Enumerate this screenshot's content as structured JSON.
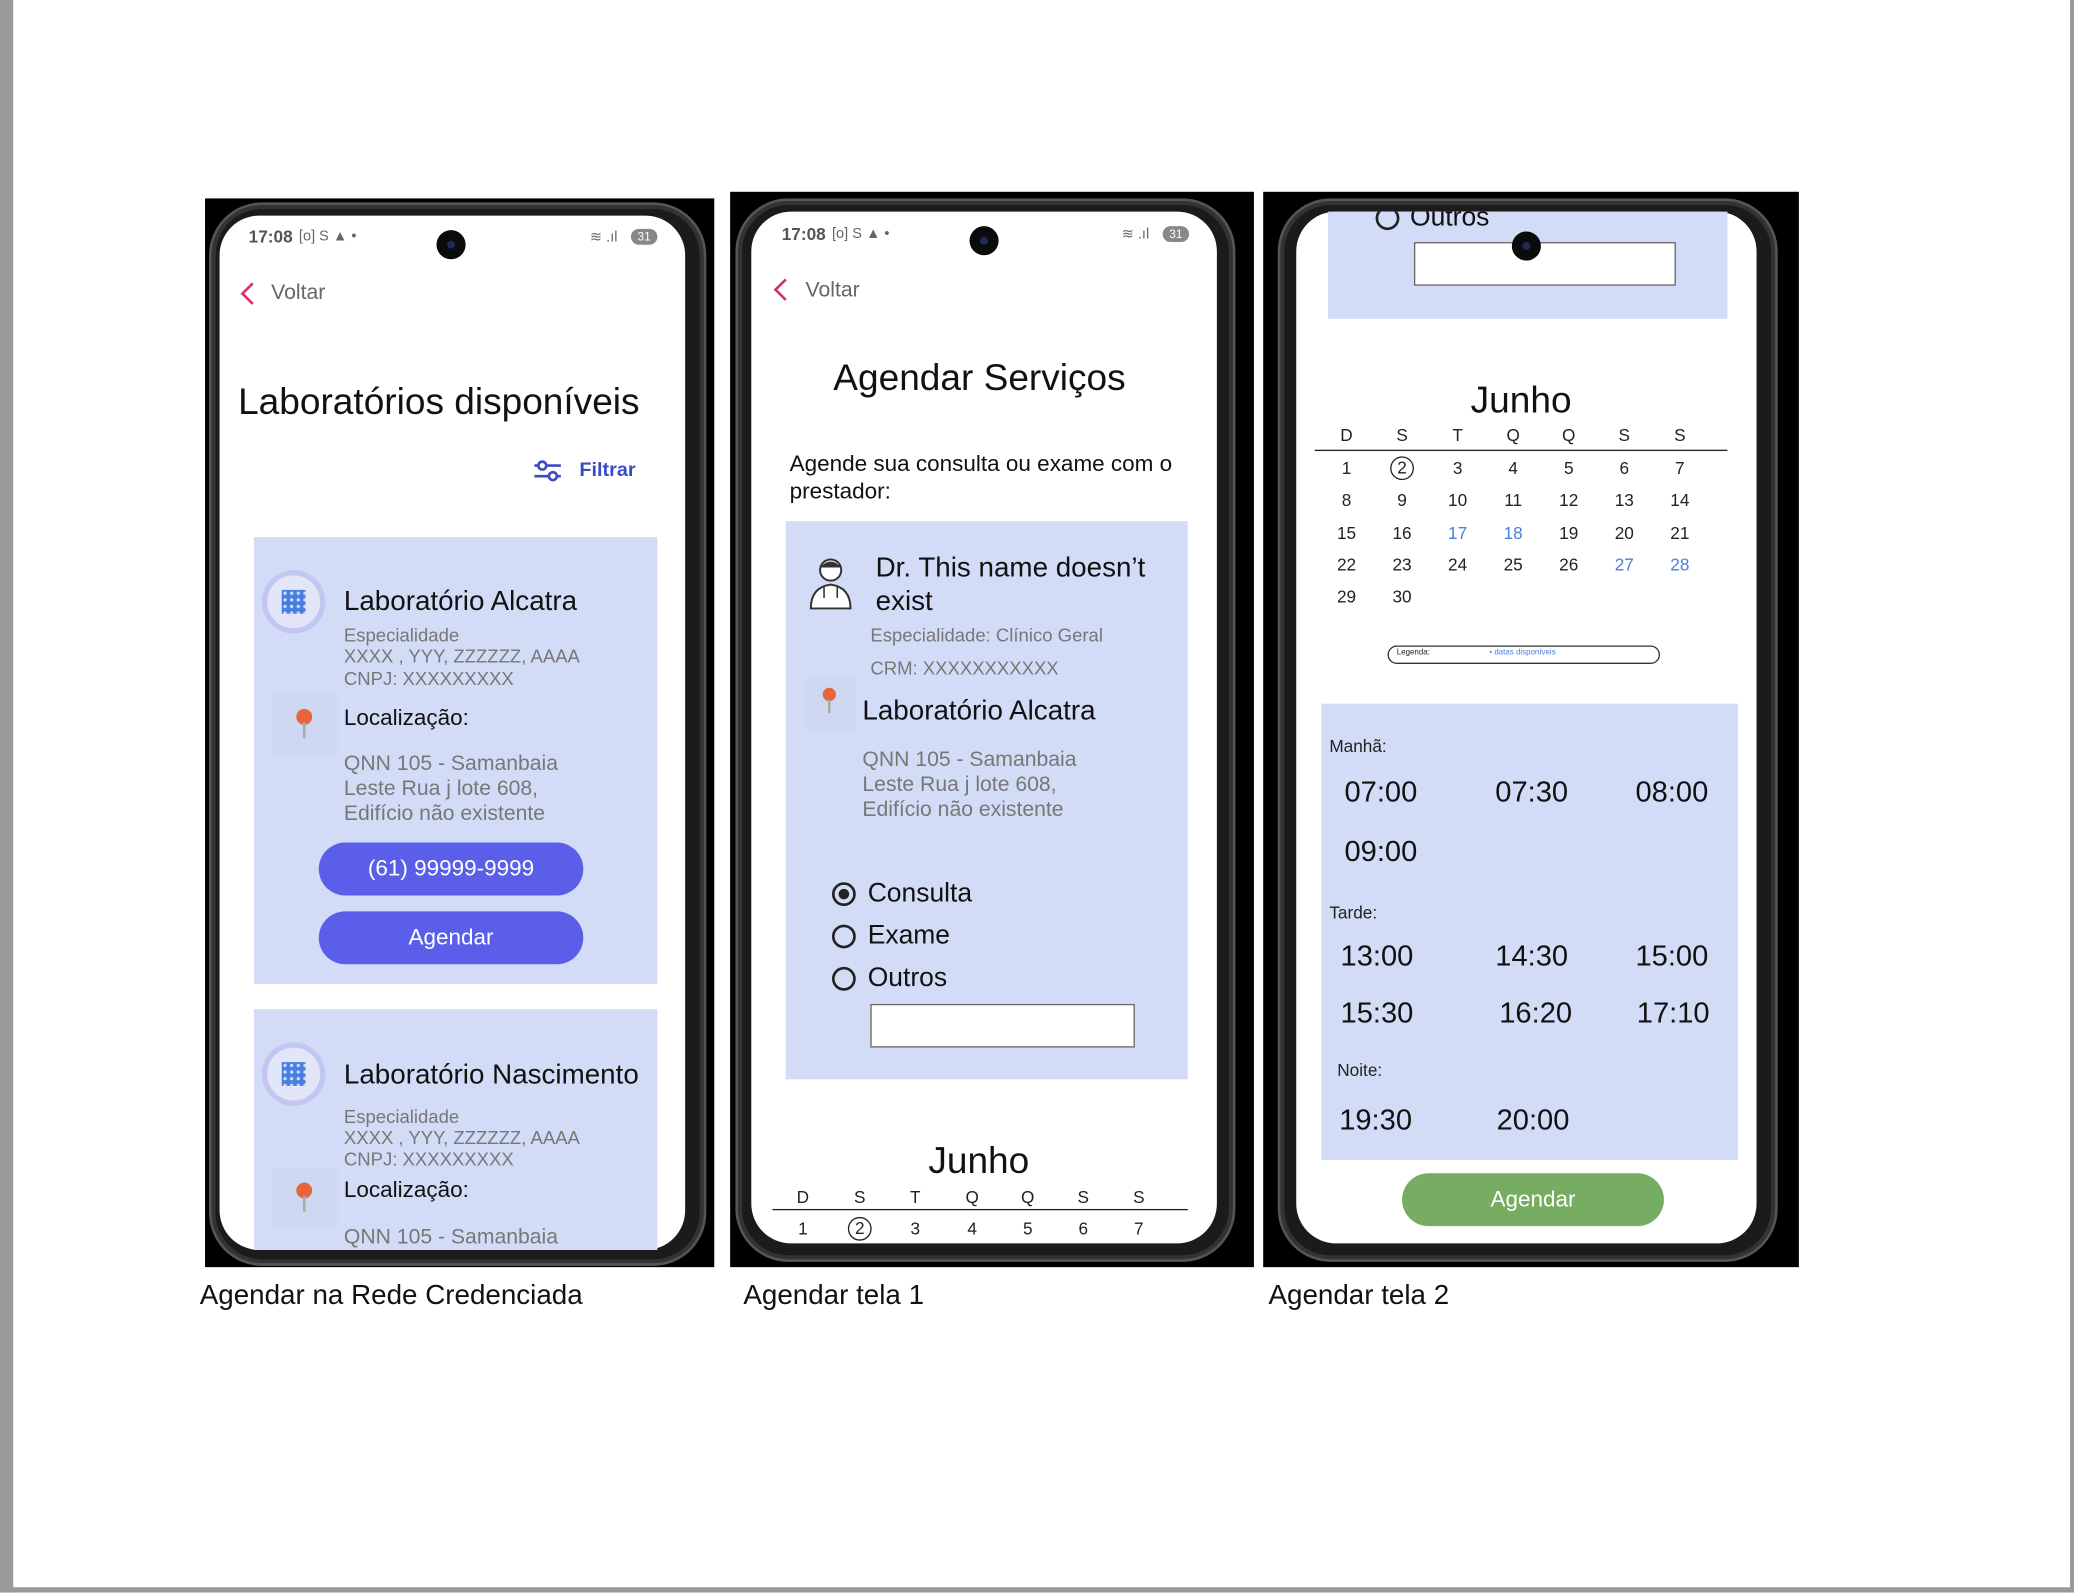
{
  "captions": [
    "Agendar na Rede Credenciada",
    "Agendar tela 1",
    "Agendar tela 2"
  ],
  "status_bar": {
    "time": "17:08",
    "icons": "[o] S ▲ •",
    "signal": "≋ .ıl",
    "battery": "31"
  },
  "screen1": {
    "back_label": "Voltar",
    "title": "Laboratórios disponíveis",
    "filter_label": "Filtrar",
    "labs": [
      {
        "name": "Laboratório Alcatra",
        "specialty_label": "Especialidade",
        "specialties": "XXXX , YYY, ZZZZZZ, AAAA",
        "cnpj": "CNPJ: XXXXXXXXX",
        "location_label": "Localização:",
        "address": [
          "QNN 105 - Samanbaia",
          "Leste  Rua j lote 608,",
          "Edifício não existente"
        ],
        "phone": "(61) 99999-9999",
        "schedule_label": "Agendar"
      },
      {
        "name": "Laboratório Nascimento",
        "specialty_label": "Especialidade",
        "specialties": "XXXX , YYY, ZZZZZZ, AAAA",
        "cnpj": "CNPJ: XXXXXXXXX",
        "location_label": "Localização:",
        "address": [
          "QNN 105 - Samanbaia"
        ]
      }
    ]
  },
  "screen2": {
    "back_label": "Voltar",
    "title": "Agendar Serviços",
    "intro": [
      "Agende sua consulta ou exame com o",
      "prestador:"
    ],
    "doctor": {
      "name": [
        "Dr. This name doesn’t",
        "exist"
      ],
      "specialty": "Especialidade: Clínico Geral",
      "crm": "CRM: XXXXXXXXXXX"
    },
    "lab": {
      "name": "Laboratório Alcatra",
      "address": [
        "QNN 105 - Samanbaia",
        "Leste  Rua j lote 608,",
        "Edifício não existente"
      ]
    },
    "options": [
      {
        "label": "Consulta",
        "checked": true
      },
      {
        "label": "Exame",
        "checked": false
      },
      {
        "label": "Outros",
        "checked": false
      }
    ],
    "other_value": "",
    "month": "Junho",
    "weekdays": [
      "D",
      "S",
      "T",
      "Q",
      "Q",
      "S",
      "S"
    ],
    "first_row": [
      "1",
      "2",
      "3",
      "4",
      "5",
      "6",
      "7"
    ]
  },
  "screen3": {
    "outros_label": "Outros",
    "month": "Junho",
    "weekdays": [
      "D",
      "S",
      "T",
      "Q",
      "Q",
      "S",
      "S"
    ],
    "days": [
      [
        "1",
        "2",
        "3",
        "4",
        "5",
        "6",
        "7"
      ],
      [
        "8",
        "9",
        "10",
        "11",
        "12",
        "13",
        "14"
      ],
      [
        "15",
        "16",
        "17",
        "18",
        "19",
        "20",
        "21"
      ],
      [
        "22",
        "23",
        "24",
        "25",
        "26",
        "27",
        "28"
      ],
      [
        "29",
        "30"
      ]
    ],
    "selected_day": "2",
    "available_days": [
      "17",
      "18",
      "27",
      "28"
    ],
    "legend_label": "Legenda:",
    "legend_item": "• datas disponíveis",
    "periods": [
      {
        "label": "Manhã:",
        "times": [
          "07:00",
          "07:30",
          "08:00",
          "09:00"
        ]
      },
      {
        "label": "Tarde:",
        "times": [
          "13:00",
          "14:30",
          "15:00",
          "15:30",
          "16:20",
          "17:10"
        ]
      },
      {
        "label": "Noite:",
        "times": [
          "19:30",
          "20:00"
        ]
      }
    ],
    "schedule_label": "Agendar"
  },
  "colors": {
    "card": "#d3dcf7",
    "primary": "#5a5ee8",
    "back": "#d6336c",
    "available": "#4a7de0",
    "confirm": "#77ac63"
  }
}
